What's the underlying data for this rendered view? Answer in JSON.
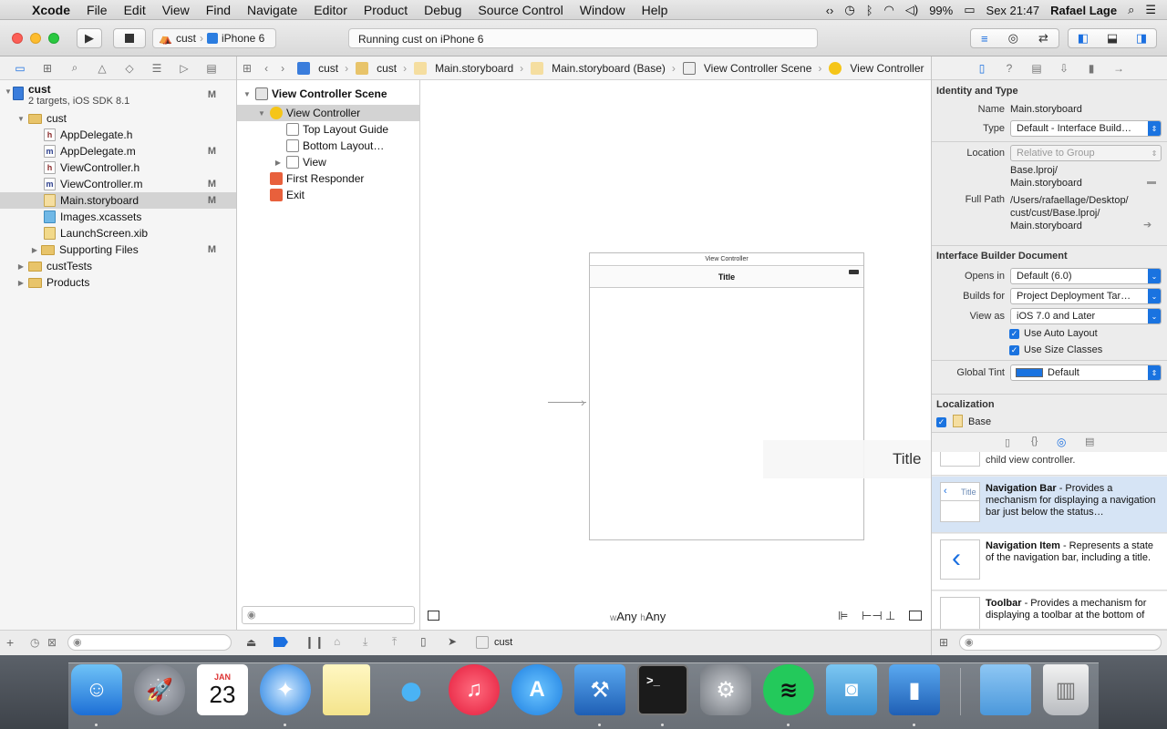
{
  "menubar": {
    "app": "Xcode",
    "items": [
      "File",
      "Edit",
      "View",
      "Find",
      "Navigate",
      "Editor",
      "Product",
      "Debug",
      "Source Control",
      "Window",
      "Help"
    ],
    "battery": "99%",
    "clock": "Sex 21:47",
    "user": "Rafael Lage"
  },
  "toolbar": {
    "scheme_target": "cust",
    "scheme_device": "iPhone 6",
    "activity": "Running cust on iPhone 6"
  },
  "navigator": {
    "project": {
      "name": "cust",
      "subtitle": "2 targets, iOS SDK 8.1",
      "badge": "M"
    },
    "items": [
      {
        "label": "cust",
        "badge": ""
      },
      {
        "label": "AppDelegate.h",
        "badge": ""
      },
      {
        "label": "AppDelegate.m",
        "badge": "M"
      },
      {
        "label": "ViewController.h",
        "badge": ""
      },
      {
        "label": "ViewController.m",
        "badge": "M"
      },
      {
        "label": "Main.storyboard",
        "badge": "M"
      },
      {
        "label": "Images.xcassets",
        "badge": ""
      },
      {
        "label": "LaunchScreen.xib",
        "badge": ""
      },
      {
        "label": "Supporting Files",
        "badge": "M"
      },
      {
        "label": "custTests",
        "badge": ""
      },
      {
        "label": "Products",
        "badge": ""
      }
    ]
  },
  "jumpbar": {
    "crumbs": [
      "cust",
      "cust",
      "Main.storyboard",
      "Main.storyboard (Base)",
      "View Controller Scene",
      "View Controller"
    ]
  },
  "outline": {
    "scene": "View Controller Scene",
    "items": [
      "View Controller",
      "Top Layout Guide",
      "Bottom Layout…",
      "View",
      "First Responder",
      "Exit"
    ]
  },
  "canvas": {
    "vc_header": "View Controller",
    "nav_title": "Title",
    "drag_title": "Title",
    "size_w": "Any",
    "size_h": "Any",
    "w_prefix": "w",
    "h_prefix": "h"
  },
  "bottom_bar": {
    "target": "cust"
  },
  "inspector": {
    "identity": {
      "title": "Identity and Type",
      "name_label": "Name",
      "name_value": "Main.storyboard",
      "type_label": "Type",
      "type_value": "Default - Interface Build…",
      "location_label": "Location",
      "location_value": "Relative to Group",
      "location_path": "Base.lproj/\nMain.storyboard",
      "fullpath_label": "Full Path",
      "fullpath_value": "/Users/rafaellage/Desktop/\ncust/cust/Base.lproj/\nMain.storyboard"
    },
    "ib_doc": {
      "title": "Interface Builder Document",
      "opens_label": "Opens in",
      "opens_value": "Default (6.0)",
      "builds_label": "Builds for",
      "builds_value": "Project Deployment Tar…",
      "viewas_label": "View as",
      "viewas_value": "iOS 7.0 and Later",
      "autolayout": "Use Auto Layout",
      "sizeclasses": "Use Size Classes",
      "tint_label": "Global Tint",
      "tint_value": "Default",
      "tint_color": "#1a73e0"
    },
    "localization": {
      "title": "Localization",
      "base": "Base"
    },
    "library": {
      "partial": "child view controller.",
      "items": [
        {
          "name": "Navigation Bar",
          "desc": " - Provides a mechanism for displaying a navigation bar just below the status…",
          "thumb_text": "Title"
        },
        {
          "name": "Navigation Item",
          "desc": " - Represents a state of the navigation bar, including a title.",
          "thumb_text": ""
        },
        {
          "name": "Toolbar",
          "desc": " - Provides a mechanism for displaying a toolbar at the bottom of",
          "thumb_text": ""
        }
      ]
    }
  },
  "dock": {
    "calendar_month": "JAN",
    "calendar_day": "23",
    "terminal_prompt": ">_"
  }
}
